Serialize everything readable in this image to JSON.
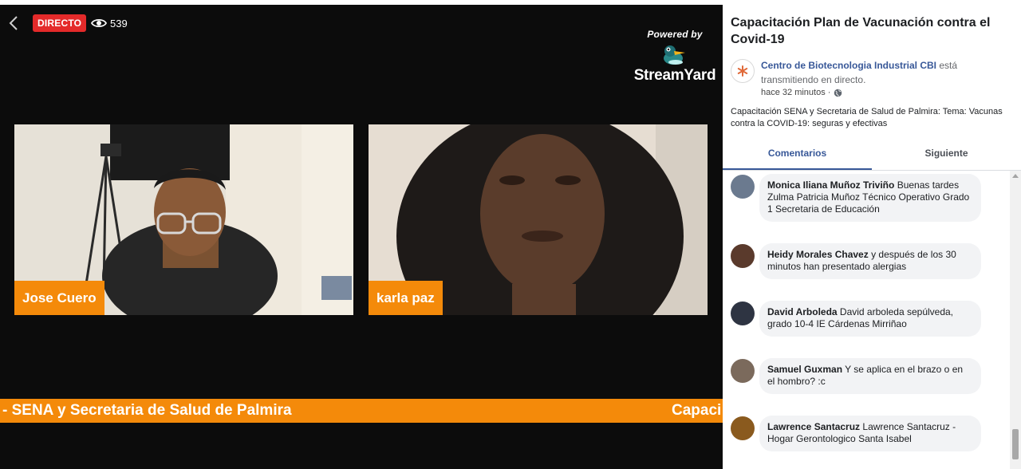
{
  "video": {
    "live_label": "DIRECTO",
    "viewer_count": "539",
    "powered_by": "Powered by",
    "brand_name": "StreamYard",
    "brand_color": "#f48a0a",
    "participants": [
      {
        "name": "Jose Cuero"
      },
      {
        "name": "karla paz"
      }
    ],
    "ticker": "- SENA y Secretaria de Salud de Palmira",
    "ticker_next": "Capaci"
  },
  "sidebar": {
    "title": "Capacitación Plan de Vacunación contra el Covid-19",
    "page_name": "Centro de Biotecnologia Industrial CBI",
    "status_text": "está transmitiendo en directo.",
    "time_ago": "hace 32 minutos ·",
    "description": "Capacitación SENA y Secretaria de Salud de Palmira: Tema: Vacunas contra la COVID-19: seguras y efectivas",
    "tabs": [
      {
        "label": "Comentarios",
        "active": true
      },
      {
        "label": "Siguiente",
        "active": false
      }
    ],
    "comments": [
      {
        "author": "Monica Iliana Muñoz Triviño",
        "text": "Buenas tardes Zulma Patricia Muñoz Técnico Operativo Grado 1 Secretaria de Educación",
        "avatar_color": "#6b7a8f"
      },
      {
        "author": "Heidy Morales Chavez",
        "text": "y después de los 30 minutos han presentado alergias",
        "avatar_color": "#5a3a2c"
      },
      {
        "author": "David Arboleda",
        "text": "David arboleda sepúlveda, grado 10-4 IE Cárdenas Mirriñao",
        "avatar_color": "#2e3442"
      },
      {
        "author": "Samuel Guxman",
        "text": "Y se aplica en el brazo o en el hombro? :c",
        "avatar_color": "#7b6a5c"
      },
      {
        "author": "Lawrence Santacruz",
        "text": "Lawrence Santacruz - Hogar Gerontologico Santa Isabel",
        "avatar_color": "#8a5a1e"
      }
    ]
  }
}
